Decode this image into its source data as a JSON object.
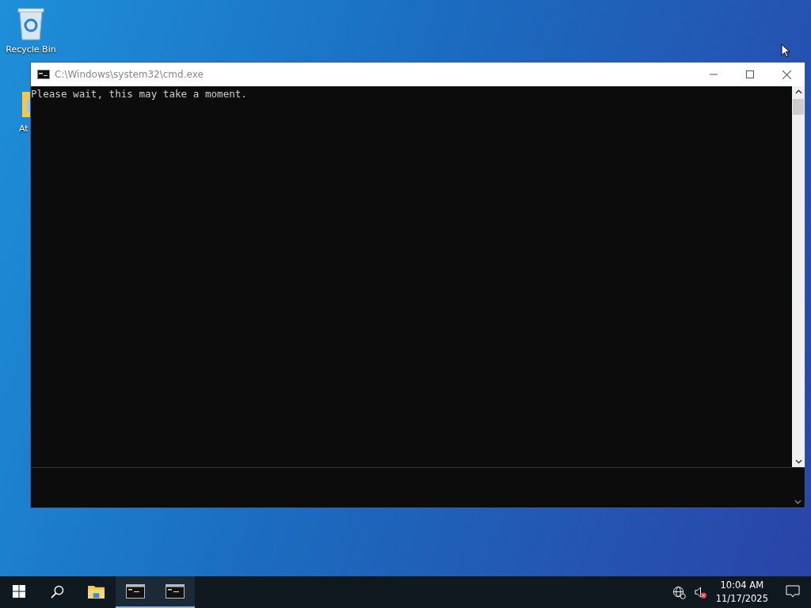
{
  "desktop_icons": [
    {
      "kind": "recycle",
      "label": "Recycle Bin"
    },
    {
      "kind": "folder",
      "label": "At"
    }
  ],
  "window": {
    "title": "C:\\Windows\\system32\\cmd.exe",
    "lines": [
      "Please wait, this may take a moment."
    ]
  },
  "taskbar": {
    "apps": [
      {
        "kind": "explorer",
        "running": false
      },
      {
        "kind": "console",
        "running": true
      },
      {
        "kind": "console",
        "running": true
      }
    ],
    "time": "10:04 AM",
    "date": "11/17/2025"
  }
}
